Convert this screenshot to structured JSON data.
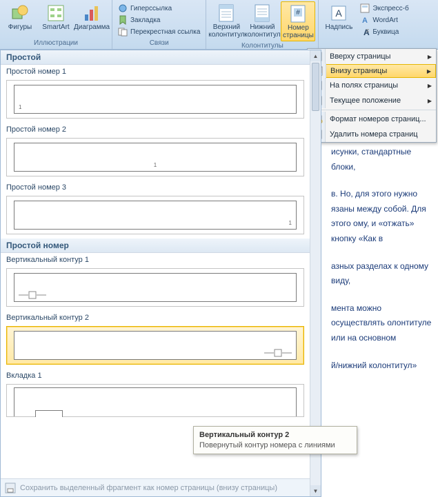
{
  "ribbon": {
    "groups": {
      "illustrations": {
        "title": "Иллюстрации",
        "shapes": "Фигуры",
        "smartart": "SmartArt",
        "chart": "Диаграмма"
      },
      "links": {
        "title": "Связи",
        "hyperlink": "Гиперссылка",
        "bookmark": "Закладка",
        "crossref": "Перекрестная ссылка"
      },
      "headers": {
        "title": "Колонтитулы",
        "header": "Верхний колонтитул",
        "footer": "Нижний колонтитул",
        "pagenum": "Номер страницы"
      },
      "text": {
        "textbox": "Надпись",
        "quickparts": "Экспресс-б",
        "wordart": "WordArt",
        "dropcap": "Буквица"
      }
    }
  },
  "submenu": {
    "top": "Вверху страницы",
    "bottom": "Внизу страницы",
    "margins": "На полях страницы",
    "current": "Текущее положение",
    "format": "Формат номеров страниц...",
    "remove": "Удалить номера страниц"
  },
  "gallery": {
    "cat_simple": "Простой",
    "simple1": "Простой номер 1",
    "simple2": "Простой номер 2",
    "simple3": "Простой номер 3",
    "cat_simplenum": "Простой номер",
    "vert1": "Вертикальный контур 1",
    "vert2": "Вертикальный контур 2",
    "tab1": "Вкладка 1",
    "footer": "Сохранить выделенный фрагмент как номер страницы (внизу страницы)"
  },
  "tooltip": {
    "title": "Вертикальный контур 2",
    "desc": "Повернутый контур номера с линиями"
  },
  "doc": {
    "p1": "исунки, стандартные блоки,",
    "p2": "в. Но, для этого нужно язаны между собой. Для этого ому, и «отжать» кнопку «Как в",
    "p3": "азных разделах к одному виду,",
    "p4": "мента можно осуществлять олонтитуле или на основном",
    "p5": "й/нижний колонтитул»"
  }
}
